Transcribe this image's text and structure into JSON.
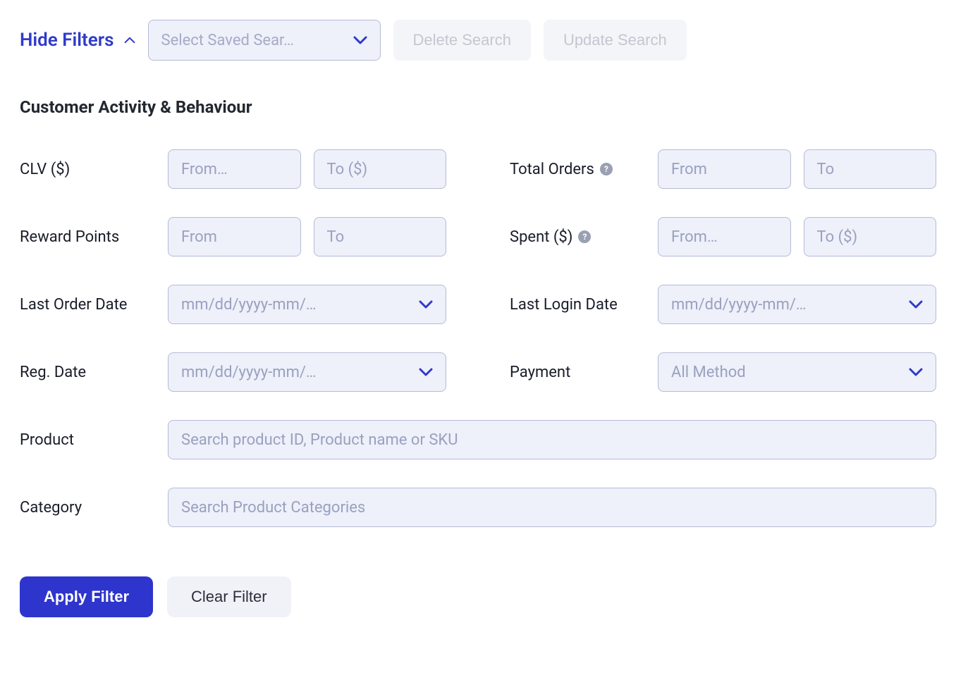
{
  "header": {
    "hide_filters_label": "Hide Filters",
    "saved_search_placeholder": "Select Saved Sear…",
    "delete_search_label": "Delete Search",
    "update_search_label": "Update Search"
  },
  "section_title": "Customer Activity & Behaviour",
  "filters": {
    "clv": {
      "label": "CLV ($)",
      "from_placeholder": "From…",
      "to_placeholder": "To ($)"
    },
    "total_orders": {
      "label": "Total Orders",
      "from_placeholder": "From",
      "to_placeholder": "To"
    },
    "reward_points": {
      "label": "Reward Points",
      "from_placeholder": "From",
      "to_placeholder": "To"
    },
    "spent": {
      "label": "Spent ($)",
      "from_placeholder": "From…",
      "to_placeholder": "To ($)"
    },
    "last_order_date": {
      "label": "Last Order Date",
      "placeholder": "mm/dd/yyyy-mm/…"
    },
    "last_login_date": {
      "label": "Last Login Date",
      "placeholder": "mm/dd/yyyy-mm/…"
    },
    "reg_date": {
      "label": "Reg. Date",
      "placeholder": "mm/dd/yyyy-mm/…"
    },
    "payment": {
      "label": "Payment",
      "selected": "All Method"
    },
    "product": {
      "label": "Product",
      "placeholder": "Search product ID, Product name or SKU"
    },
    "category": {
      "label": "Category",
      "placeholder": "Search Product Categories"
    }
  },
  "actions": {
    "apply": "Apply Filter",
    "clear": "Clear Filter"
  },
  "help_glyph": "?"
}
